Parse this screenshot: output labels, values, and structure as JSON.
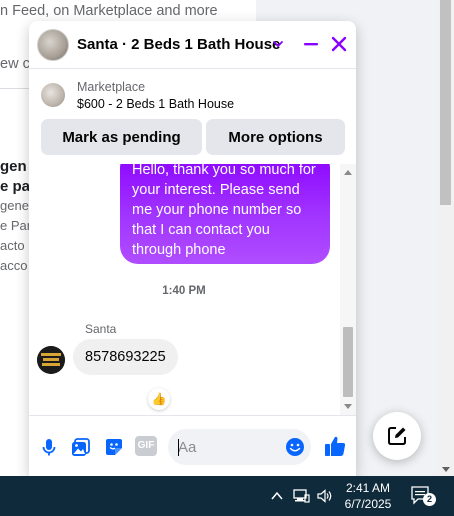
{
  "background": {
    "lines": [
      "n Feed, on Marketplace and more",
      "ew c",
      "gen",
      "e pa",
      "gener",
      "e Par",
      "acto",
      "acco"
    ]
  },
  "chat": {
    "header": {
      "title": "Santa · 2 Beds 1 Bath House",
      "dropdown_icon": "chevron-down-icon",
      "minimize_icon": "minimize-icon",
      "close_icon": "close-icon",
      "accent_color": "#8a00ff"
    },
    "listing": {
      "kicker": "Marketplace",
      "title": "$600 - 2 Beds 1 Bath House",
      "buttons": {
        "pending": "Mark as pending",
        "more": "More options"
      }
    },
    "messages": {
      "outgoing_text": "Hello, thank you so much for your interest. Please send me your phone number so that I can contact you through phone",
      "timestamp": "1:40 PM",
      "sender_name": "Santa",
      "incoming_text": "8578693225",
      "reaction": "👍",
      "outgoing_gradient": [
        "#8b00ff",
        "#b04dff"
      ]
    },
    "composer": {
      "placeholder": "Aa",
      "icons": [
        "microphone-icon",
        "photo-icon",
        "sticker-icon",
        "gif-icon",
        "emoji-icon",
        "like-icon"
      ],
      "gif_label": "GIF"
    }
  },
  "new_message_icon": "compose-icon",
  "taskbar": {
    "time": "2:41 AM",
    "date": "6/7/2025",
    "notification_count": "2",
    "tray_icons": [
      "chevron-up-icon",
      "network-icon",
      "volume-icon",
      "notification-icon"
    ]
  }
}
